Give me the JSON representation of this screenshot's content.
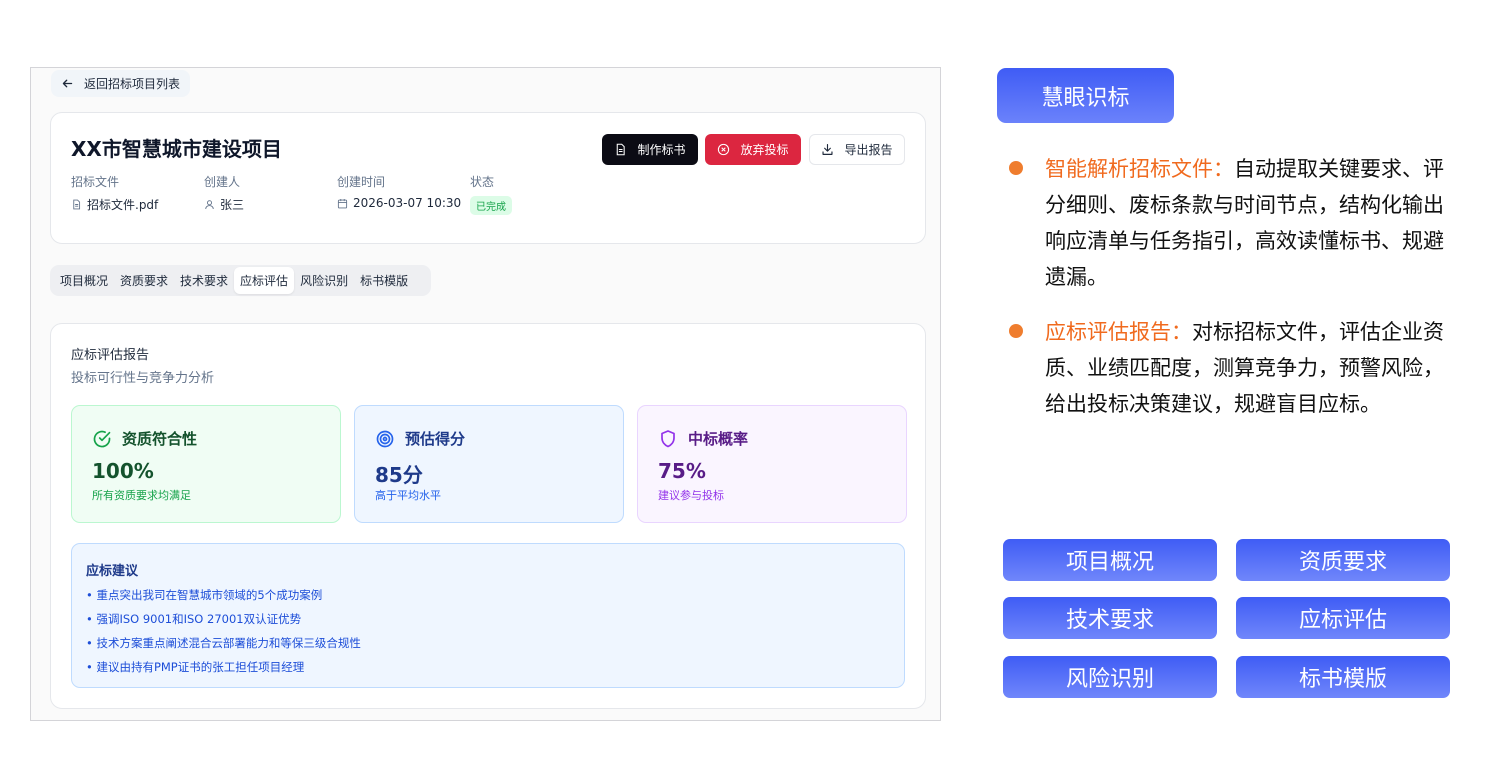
{
  "app": {
    "back_label": "返回招标项目列表",
    "project_title": "XX市智慧城市建设项目",
    "meta": {
      "file_label": "招标文件",
      "file_value": "招标文件.pdf",
      "creator_label": "创建人",
      "creator_value": "张三",
      "time_label": "创建时间",
      "time_value": "2026-03-07 10:30",
      "status_label": "状态",
      "status_value": "已完成"
    },
    "actions": {
      "make_label": "制作标书",
      "abandon_label": "放弃投标",
      "export_label": "导出报告"
    },
    "tabs": [
      {
        "label": "项目概况",
        "active": false
      },
      {
        "label": "资质要求",
        "active": false
      },
      {
        "label": "技术要求",
        "active": false
      },
      {
        "label": "应标评估",
        "active": true
      },
      {
        "label": "风险识别",
        "active": false
      },
      {
        "label": "标书模版",
        "active": false
      }
    ],
    "report": {
      "title": "应标评估报告",
      "subtitle": "投标可行性与竞争力分析",
      "stats": [
        {
          "icon": "check-circle-icon",
          "title": "资质符合性",
          "value": "100%",
          "desc": "所有资质要求均满足",
          "color": "#16a34a"
        },
        {
          "icon": "target-icon",
          "title": "预估得分",
          "value": "85分",
          "desc": "高于平均水平",
          "color": "#2563eb"
        },
        {
          "icon": "shield-icon",
          "title": "中标概率",
          "value": "75%",
          "desc": "建议参与投标",
          "color": "#9333ea"
        }
      ],
      "advice_title": "应标建议",
      "advice_items": [
        "• 重点突出我司在智慧城市领域的5个成功案例",
        "• 强调ISO 9001和ISO 27001双认证优势",
        "• 技术方案重点阐述混合云部署能力和等保三级合规性",
        "• 建议由持有PMP证书的张工担任项目经理"
      ]
    }
  },
  "panel": {
    "brand": "慧眼识标",
    "features": [
      {
        "highlight": "智能解析招标文件：",
        "text": "自动提取关键要求、评分细则、废标条款与时间节点，结构化输出响应清单与任务指引，高效读懂标书、规避遗漏。"
      },
      {
        "highlight": "应标评估报告：",
        "text": "对标招标文件，评估企业资质、业绩匹配度，测算竞争力，预警风险，给出投标决策建议，规避盲目应标。"
      }
    ],
    "nav_buttons": [
      "项目概况",
      "资质要求",
      "技术要求",
      "应标评估",
      "风险识别",
      "标书模版"
    ],
    "accent_color": "#4f6cf7",
    "highlight_color": "#f06a1e"
  }
}
